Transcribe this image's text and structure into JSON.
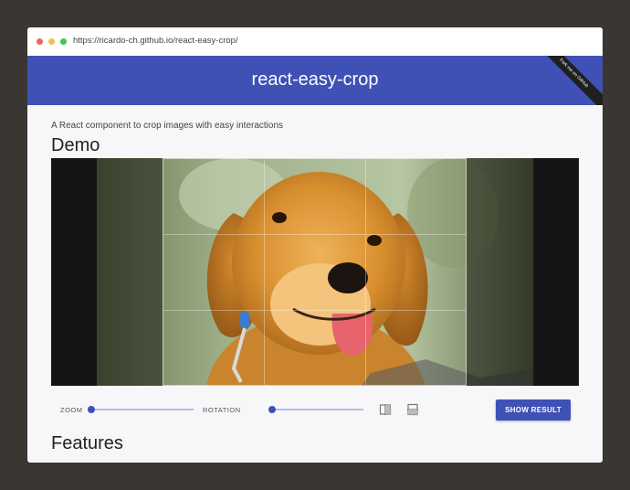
{
  "browser": {
    "url": "https://ricardo-ch.github.io/react-easy-crop/"
  },
  "header": {
    "title": "react-easy-crop",
    "ribbon": "Fork me on GitHub"
  },
  "intro": {
    "subtitle": "A React component to crop images with easy interactions",
    "demo_heading": "Demo"
  },
  "controls": {
    "zoom_label": "ZOOM",
    "zoom_value": 0.0,
    "rotation_label": "ROTATION",
    "rotation_value": 0.0,
    "flip_horizontal_icon": "flip-horizontal-icon",
    "flip_vertical_icon": "flip-vertical-icon",
    "show_result_label": "SHOW RESULT"
  },
  "features": {
    "heading": "Features"
  },
  "colors": {
    "primary": "#3f51b5",
    "page_background": "#f7f7f9",
    "outer_background": "#3a3732"
  }
}
